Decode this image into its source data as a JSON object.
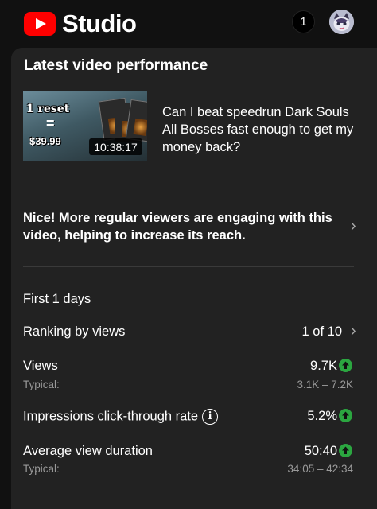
{
  "header": {
    "app_name": "Studio",
    "notification_count": "1",
    "icons": [
      "youtube-logo",
      "avatar"
    ]
  },
  "section": {
    "title": "Latest video performance"
  },
  "video": {
    "title": "Can I beat speedrun Dark Souls All Bosses fast enough to get my money back?",
    "duration": "10:38:17",
    "thumbnail_text": {
      "line1": "1 reset",
      "line2": "=",
      "line3": "$39.99"
    }
  },
  "insight": {
    "text": "Nice! More regular viewers are engaging with this video, helping to increase its reach."
  },
  "stats": {
    "period": "First 1 days",
    "ranking": {
      "label": "Ranking by views",
      "value": "1 of 10"
    },
    "views": {
      "label": "Views",
      "value": "9.7K",
      "typical_label": "Typical:",
      "typical_range": "3.1K – 7.2K"
    },
    "ctr": {
      "label": "Impressions click-through rate",
      "value": "5.2%"
    },
    "avd": {
      "label": "Average view duration",
      "value": "50:40",
      "typical_label": "Typical:",
      "typical_range": "34:05 – 42:34"
    }
  },
  "colors": {
    "brand_red": "#ff0000",
    "up_green": "#2ba640",
    "background": "#111111",
    "card": "#222222"
  }
}
